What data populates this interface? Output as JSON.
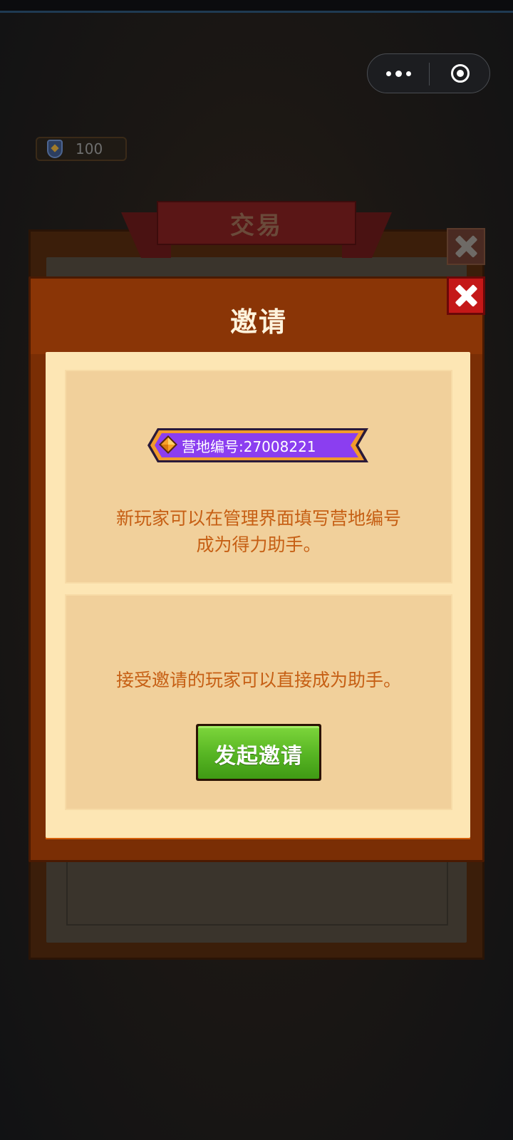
{
  "status": {
    "shield_value": "100"
  },
  "trade": {
    "title": "交易"
  },
  "dialog": {
    "title": "邀请",
    "camp_id_label": "营地编号:27008221",
    "section1_line1": "新玩家可以在管理界面填写营地编号",
    "section1_line2": "成为得力助手。",
    "section2_text": "接受邀请的玩家可以直接成为助手。",
    "invite_button": "发起邀请"
  },
  "icons": {
    "capsule_more": "more-dots-icon",
    "capsule_close": "target-circle-icon",
    "shield": "shield-icon",
    "close": "close-x-icon",
    "gem": "gem-icon"
  },
  "colors": {
    "dialog_frame": "#8a3506",
    "dialog_body": "#fde6b4",
    "section_bg": "#f1d09b",
    "text_orange": "#c65f14",
    "badge_purple": "#8b3ef0",
    "button_green": "#58b624",
    "close_red": "#c41818"
  }
}
